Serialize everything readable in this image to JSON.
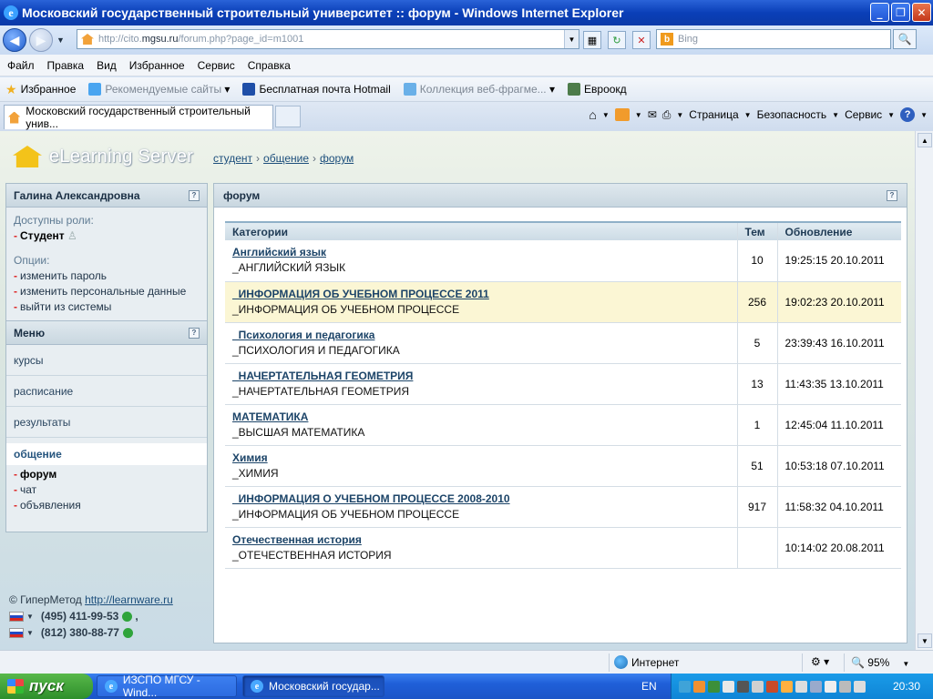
{
  "window": {
    "title": "Московский государственный строительный университет :: форум - Windows Internet Explorer"
  },
  "address": {
    "url_prefix": "http://cito.",
    "url_domain": "mgsu.ru",
    "url_suffix": "/forum.php?page_id=m1001",
    "search_placeholder": "Bing"
  },
  "menu": [
    "Файл",
    "Правка",
    "Вид",
    "Избранное",
    "Сервис",
    "Справка"
  ],
  "favorites": {
    "label": "Избранное",
    "items": [
      "Рекомендуемые сайты",
      "Бесплатная почта Hotmail",
      "Коллекция веб-фрагме...",
      "Евроокд"
    ]
  },
  "tab": {
    "title": "Московский государственный строительный унив..."
  },
  "commandbar": {
    "page": "Страница",
    "safety": "Безопасность",
    "tools": "Сервис"
  },
  "site": {
    "logo": "eLearning Server",
    "breadcrumbs": [
      "студент",
      "общение",
      "форум"
    ]
  },
  "sidebar": {
    "user": "Галина  Александровна",
    "roles_label": "Доступны роли:",
    "role": "Студент",
    "options_label": "Опции:",
    "options": [
      "изменить пароль",
      "изменить персональные данные",
      "выйти из системы"
    ],
    "menu_title": "Меню",
    "menu_items": [
      "курсы",
      "расписание",
      "результаты"
    ],
    "active_item": "общение",
    "sub_items": [
      "форум",
      "чат",
      "объявления"
    ]
  },
  "footer": {
    "copyright": "© ГиперМетод",
    "link": "http://learnware.ru",
    "phone1": "(495) 411-99-53",
    "phone2": "(812) 380-88-77"
  },
  "forum": {
    "title": "форум",
    "columns": [
      "Категории",
      "Тем",
      "Обновление"
    ],
    "rows": [
      {
        "name": "Английский язык",
        "desc": "_АНГЛИЙСКИЙ ЯЗЫК",
        "topics": "10",
        "updated": "19:25:15 20.10.2011"
      },
      {
        "name": "_ИНФОРМАЦИЯ ОБ УЧЕБНОМ ПРОЦЕССЕ 2011",
        "desc": "_ИНФОРМАЦИЯ ОБ УЧЕБНОМ ПРОЦЕССЕ",
        "topics": "256",
        "updated": "19:02:23 20.10.2011"
      },
      {
        "name": "_Психология и педагогика",
        "desc": "_ПСИХОЛОГИЯ И ПЕДАГОГИКА",
        "topics": "5",
        "updated": "23:39:43 16.10.2011"
      },
      {
        "name": "_НАЧЕРТАТЕЛЬНАЯ ГЕОМЕТРИЯ",
        "desc": "_НАЧЕРТАТЕЛЬНАЯ ГЕОМЕТРИЯ",
        "topics": "13",
        "updated": "11:43:35 13.10.2011"
      },
      {
        "name": "МАТЕМАТИКА",
        "desc": "_ВЫСШАЯ МАТЕМАТИКА",
        "topics": "1",
        "updated": "12:45:04 11.10.2011"
      },
      {
        "name": "Химия",
        "desc": "_ХИМИЯ",
        "topics": "51",
        "updated": "10:53:18 07.10.2011"
      },
      {
        "name": "_ИНФОРМАЦИЯ О УЧЕБНОМ ПРОЦЕССЕ 2008-2010",
        "desc": "_ИНФОРМАЦИЯ ОБ УЧЕБНОМ ПРОЦЕССЕ",
        "topics": "917",
        "updated": "11:58:32 04.10.2011"
      },
      {
        "name": "Отечественная история",
        "desc": "_ОТЕЧЕСТВЕННАЯ ИСТОРИЯ",
        "topics": "",
        "updated": "10:14:02 20.08.2011"
      }
    ]
  },
  "statusbar": {
    "zone": "Интернет",
    "zoom": "95%"
  },
  "taskbar": {
    "start": "пуск",
    "tasks": [
      "ИЗСПО МГСУ - Wind...",
      "Московский государ..."
    ],
    "lang": "EN",
    "clock": "20:30"
  }
}
